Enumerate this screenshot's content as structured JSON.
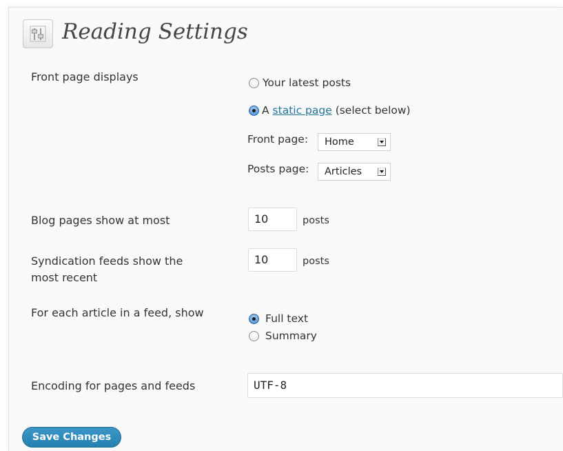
{
  "page": {
    "title": "Reading Settings"
  },
  "front_page_displays": {
    "label": "Front page displays",
    "option_latest": "Your latest posts",
    "option_static_prefix": "A",
    "option_static_link": "static page",
    "option_static_suffix": "(select below)",
    "selected": "static",
    "front_page_label": "Front page:",
    "front_page_value": "Home",
    "posts_page_label": "Posts page:",
    "posts_page_value": "Articles"
  },
  "blog_pages": {
    "label": "Blog pages show at most",
    "value": "10",
    "unit": "posts"
  },
  "syndication": {
    "label_line1": "Syndication feeds show the",
    "label_line2": "most recent",
    "value": "10",
    "unit": "posts"
  },
  "feed_article": {
    "label": "For each article in a feed, show",
    "option_full": "Full text",
    "option_summary": "Summary",
    "selected": "full"
  },
  "encoding": {
    "label": "Encoding for pages and feeds",
    "value": "UTF-8"
  },
  "actions": {
    "save_label": "Save Changes"
  },
  "colors": {
    "link": "#21759b",
    "button": "#2580b0",
    "panel_bg": "#f9f9f9"
  }
}
